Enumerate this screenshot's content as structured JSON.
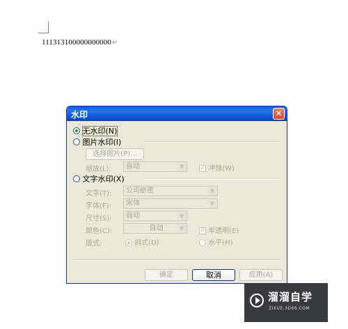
{
  "document": {
    "line_text": "111313100000000000",
    "paragraph_mark": "↵"
  },
  "dialog": {
    "title": "水印",
    "close_symbol": "✕",
    "options": {
      "no_watermark": "无水印(N)",
      "picture_watermark": "图片水印(I)",
      "text_watermark": "文字水印(X)"
    },
    "picture": {
      "select_button": "选择图片(P)...",
      "scale_label": "缩放(L):",
      "scale_value": "自动",
      "washout_label": "冲蚀(W)",
      "washout_checked": true
    },
    "text": {
      "text_label": "文字(T):",
      "text_value": "公司绝密",
      "font_label": "字体(F):",
      "font_value": "宋体",
      "size_label": "尺寸(S):",
      "size_value": "自动",
      "color_label": "颜色(C):",
      "color_value": "自动",
      "semitransparent_label": "半透明(E)",
      "semitransparent_checked": true,
      "layout_label": "版式:",
      "diagonal_label": "斜式(D)",
      "horizontal_label": "水平(H)"
    },
    "buttons": {
      "ok": "确定",
      "cancel": "取消",
      "apply": "应用(A)"
    },
    "selected_option": "no_watermark"
  },
  "watermark": {
    "name": "溜溜自学",
    "url": "ZIXUE.3D66.COM"
  },
  "colors": {
    "titlebar": "#0a5fe3",
    "dialog_bg": "#ece9d8",
    "close_button": "#d8452a",
    "disabled_text": "#aca899"
  }
}
